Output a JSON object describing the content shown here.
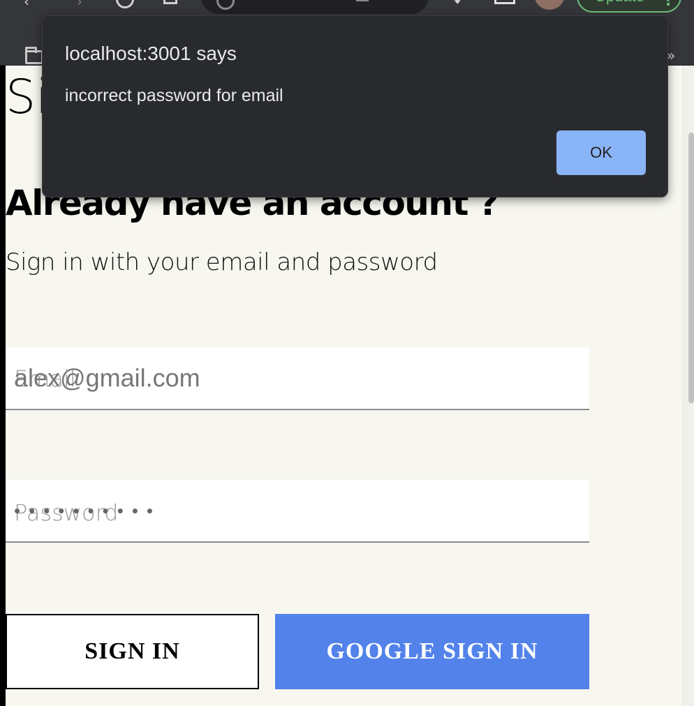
{
  "browser": {
    "update_label": "Update",
    "more_label": "»"
  },
  "page": {
    "heading": "Sign In",
    "subheading": "Already have an account ?",
    "instructions": "Sign in with your email and password",
    "email": {
      "label": "Email",
      "value": "alex@gmail.com",
      "type": "email"
    },
    "password": {
      "label": "Password",
      "value": "••••••••••",
      "type": "password"
    },
    "sign_in_button": "SIGN IN",
    "google_button": "GOOGLE SIGN IN"
  },
  "dialog": {
    "title": "localhost:3001 says",
    "message": "incorrect password for email",
    "ok_label": "OK"
  },
  "colors": {
    "page_background": "#f7f7f0",
    "google_button": "#5282ea",
    "dialog_background": "#292a2d",
    "dialog_button": "#8ab4f8",
    "update_accent": "#6fbf7a"
  }
}
